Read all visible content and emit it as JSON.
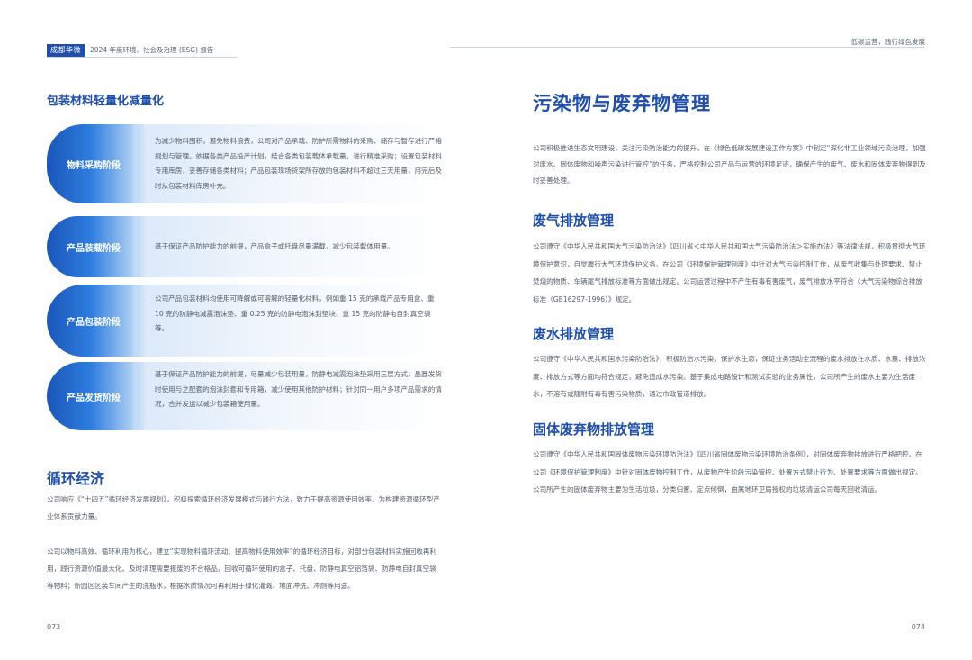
{
  "header": {
    "brand": "成都华微",
    "report_title": "2024 年度环境、社会及治理 (ESG) 报告",
    "right_text": "低碳运营，践行绿色发展"
  },
  "left": {
    "section_title": "包装材料轻量化减量化",
    "stages": [
      {
        "label": "物料采购阶段",
        "text": "为减少物料囤积，避免物料浪费，公司对产品承载、防护所需物料的采购、储存与暂存进行严格规划与管理。依据各类产品投产计划，结合各类包装载体承载量，进行精准采购；设置包装材料专用库房，妥善存储各类材料；产品包装现场货架所存放的包装材料不超过三天用量，用完后及时从包装材料库房补充。"
      },
      {
        "label": "产品装载阶段",
        "text": "基于保证产品防护能力的前提，产品盒子或托盘尽量满载，减少包装载体用量。"
      },
      {
        "label": "产品包装阶段",
        "text": "公司产品包装材料均使用可降解或可溶解的轻量化材料，例如重 15 克的承载产品专用盒、重 10 克的防静电减震泡沫垫、重 0.25 克的防静电泡沫封垫块、重 15 克的防静电自封真空袋等。"
      },
      {
        "label": "产品发货阶段",
        "text": "基于保证产品防护能力的前提，尽量减少包装用量，防静电减震泡沫垫采用三层方式；晶圆发货时使用与之配套的泡沫封套和专用箱，减少使用其他防护材料；针对同一用户多项产品需求的情况，合并发运以减少包装箱使用量。"
      }
    ],
    "circular_title": "循环经济",
    "circular_p1": "公司响应《“十四五”循环经济发展规划》，积极探索循环经济发展模式与践行方法，致力于提高资源使用效率，为构建资源循环型产业体系贡献力量。",
    "circular_p2": "公司以物料高效、循环利用为核心，建立“实现物料循环流动、提高物料使用效率”的循环经济目标，对部分包装材料实施回收再利用，践行资源价值最大化。及时清理需要报废的不合格品，回收可循环使用的盒子、托盘、防静电真空铝箔袋、防静电自封真空袋等物料；新园区区装车间产生的洗瓶水，根据水质情况可再利用于绿化灌溉、地面冲洗、冲厕等用途。",
    "page_number": "073"
  },
  "right": {
    "main_title": "污染物与废弃物管理",
    "intro": "公司积极推进生态文明建设，关注污染防治能力的提升，在《绿色低碳发展建设工作方案》中制定“深化非工业领域污染治理，加强对废水、固体废物和噪声污染进行管控”的任务，严格控制公司产品与运营的环境足迹，确保产生的废气、废水和固体废弃物得到及时妥善处理。",
    "sections": [
      {
        "title": "废气排放管理",
        "text": "公司遵守《中华人民共和国大气污染防治法》《四川省＜中华人民共和国大气污染防治法＞实施办法》等法律法规，积极贯彻大气环境保护意识，自觉履行大气环境保护义务。在公司《环境保护管理制度》中针对大气污染控制工作，从废气收集与处理要求、禁止焚烧的物质、车辆尾气排放标准等方面做出规定。公司运营过程中不产生有毒有害废气，废气排放水平符合《大气污染物综合排放标准（GB16297-1996）》规定。"
      },
      {
        "title": "废水排放管理",
        "text": "公司遵守《中华人民共和国水污染防治法》，积极防治水污染，保护水生态，保证业务活动全流程的废水排放在水质、水量、排放浓度、排放方式等方面均符合规定，避免造成水污染。基于集成电路设计和测试实验的业务属性，公司所产生的废水主要为生活废水，不溶有或随附有毒有害污染物质，通过市政管道排放。"
      },
      {
        "title": "固体废弃物排放管理",
        "text": "公司遵守《中华人民共和国固体废物污染环境防治法》《四川省固体废物污染环境防治条例》，对固体废弃物排放进行严格把控。在公司《环境保护管理制度》中针对固体废物控制工作，从废物产生阶段污染管控、处置方式禁止行为、处置要求等方面做出规定。公司所产生的固体废弃物主要为生活垃圾，分类归置、定点倾倒，由属地环卫局授权的垃圾清运公司每天回收清运。"
      }
    ],
    "page_number": "074"
  }
}
